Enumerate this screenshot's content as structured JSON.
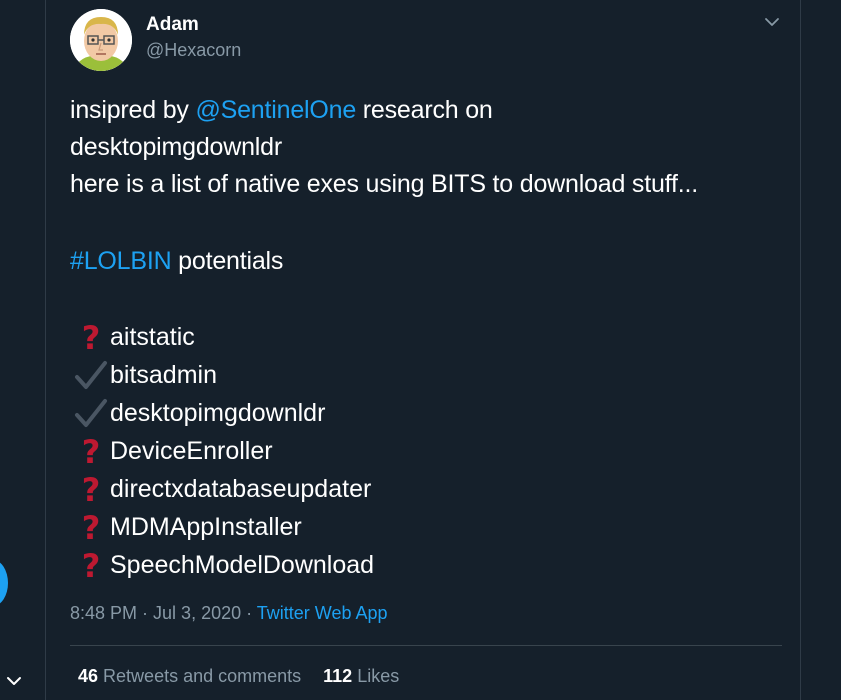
{
  "author": {
    "display_name": "Adam",
    "handle": "@Hexacorn"
  },
  "tweet": {
    "intro_before_mention": "insipred by ",
    "mention": "@SentinelOne",
    "intro_after_mention": " research on",
    "line2": "desktopimgdownldr",
    "line3": "here is a list of native exes using BITS to download stuff...",
    "hashtag": "#LOLBIN",
    "hashtag_suffix": " potentials",
    "items": [
      {
        "status": "question",
        "label": "aitstatic"
      },
      {
        "status": "check",
        "label": "bitsadmin"
      },
      {
        "status": "check",
        "label": "desktopimgdownldr"
      },
      {
        "status": "question",
        "label": "DeviceEnroller"
      },
      {
        "status": "question",
        "label": "directxdatabaseupdater"
      },
      {
        "status": "question",
        "label": "MDMAppInstaller"
      },
      {
        "status": "question",
        "label": "SpeechModelDownload"
      }
    ]
  },
  "meta": {
    "time": "8:48 PM",
    "separator": " · ",
    "date": "Jul 3, 2020",
    "separator2": " · ",
    "source": "Twitter Web App"
  },
  "stats": {
    "retweets_count": "46",
    "retweets_label": "Retweets and comments",
    "likes_count": "112",
    "likes_label": "Likes"
  },
  "colors": {
    "background": "#15202b",
    "link": "#1da1f2",
    "muted": "#8899a6",
    "question_mark": "#be1931",
    "check_mark": "#4a5663"
  },
  "icons": {
    "caret": "chevron-down-icon",
    "question": "red-question-mark-icon",
    "check": "check-mark-icon"
  }
}
